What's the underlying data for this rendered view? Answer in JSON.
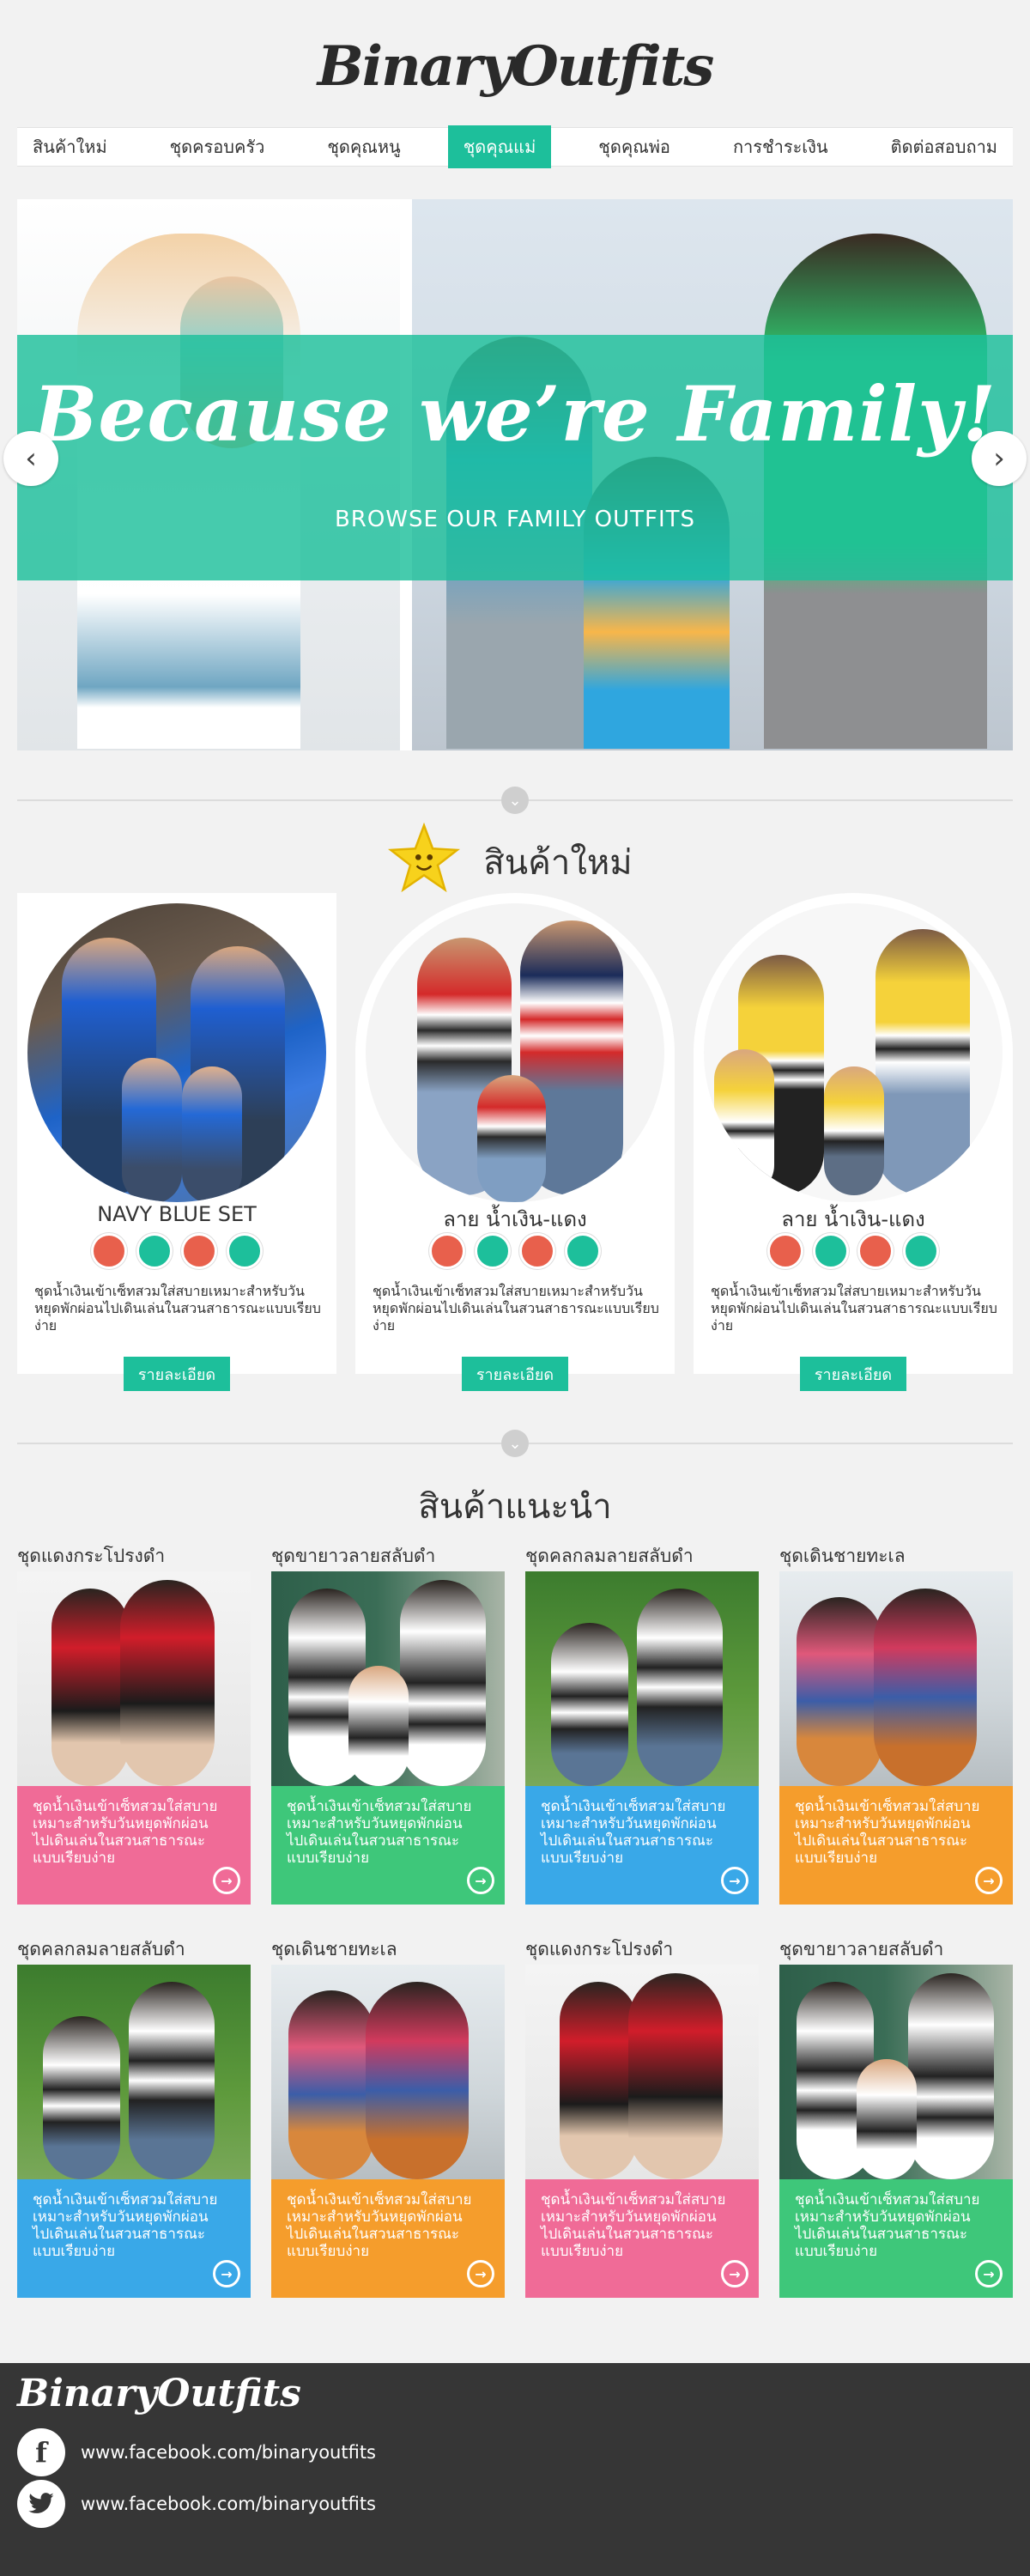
{
  "header": {
    "logo": "BinaryOutfits"
  },
  "nav": {
    "items": [
      {
        "label": "สินค้าใหม่",
        "active": false
      },
      {
        "label": "ชุดครอบครัว",
        "active": false
      },
      {
        "label": "ชุดคุณหนู",
        "active": false
      },
      {
        "label": "ชุดคุณแม่",
        "active": true
      },
      {
        "label": "ชุดคุณพ่อ",
        "active": false
      },
      {
        "label": "การชำระเงิน",
        "active": false
      },
      {
        "label": "ติดต่อสอบถาม",
        "active": false
      }
    ]
  },
  "hero": {
    "title": "Because we’re Family!",
    "subtitle": "BROWSE OUR FAMILY OUTFITS",
    "prev_icon": "chevron-left-icon",
    "next_icon": "chevron-right-icon"
  },
  "new_products": {
    "title": "สินค้าใหม่",
    "icon": "star-icon",
    "items": [
      {
        "name": "NAVY BLUE SET",
        "description": "ชุดน้ำเงินเข้าเซ็ทสวมใส่สบายเหมาะสำหรับวันหยุดพักผ่อนไปเดินเล่นในสวนสาธารณะแบบเรียบง่าย",
        "button": "รายละเอียด",
        "swatches": [
          "#e8604c",
          "#1dbf9b",
          "#e8604c",
          "#1dbf9b"
        ]
      },
      {
        "name": "ลาย น้ำเงิน-แดง",
        "description": "ชุดน้ำเงินเข้าเซ็ทสวมใส่สบายเหมาะสำหรับวันหยุดพักผ่อนไปเดินเล่นในสวนสาธารณะแบบเรียบง่าย",
        "button": "รายละเอียด",
        "swatches": [
          "#e8604c",
          "#1dbf9b",
          "#e8604c",
          "#1dbf9b"
        ]
      },
      {
        "name": "ลาย น้ำเงิน-แดง",
        "description": "ชุดน้ำเงินเข้าเซ็ทสวมใส่สบายเหมาะสำหรับวันหยุดพักผ่อนไปเดินเล่นในสวนสาธารณะแบบเรียบง่าย",
        "button": "รายละเอียด",
        "swatches": [
          "#e8604c",
          "#1dbf9b",
          "#e8604c",
          "#1dbf9b"
        ]
      }
    ]
  },
  "recommended": {
    "title": "สินค้าแนะนำ",
    "items": [
      {
        "title": "ชุดแดงกระโปรงดำ",
        "caption": "ชุดน้ำเงินเข้าเซ็ทสวมใส่สบายเหมาะสำหรับวันหยุดพักผ่อนไปเดินเล่นในสวนสาธารณะแบบเรียบง่าย",
        "color": "#f06b97"
      },
      {
        "title": "ชุดขายาวลายสลับดำ",
        "caption": "ชุดน้ำเงินเข้าเซ็ทสวมใส่สบายเหมาะสำหรับวันหยุดพักผ่อนไปเดินเล่นในสวนสาธารณะแบบเรียบง่าย",
        "color": "#3ec77a"
      },
      {
        "title": "ชุดคลกลมลายสลับดำ",
        "caption": "ชุดน้ำเงินเข้าเซ็ทสวมใส่สบายเหมาะสำหรับวันหยุดพักผ่อนไปเดินเล่นในสวนสาธารณะแบบเรียบง่าย",
        "color": "#39a8e8"
      },
      {
        "title": "ชุดเดินชายทะเล",
        "caption": "ชุดน้ำเงินเข้าเซ็ทสวมใส่สบายเหมาะสำหรับวันหยุดพักผ่อนไปเดินเล่นในสวนสาธารณะแบบเรียบง่าย",
        "color": "#f59d2c"
      },
      {
        "title": "ชุดคลกลมลายสลับดำ",
        "caption": "ชุดน้ำเงินเข้าเซ็ทสวมใส่สบายเหมาะสำหรับวันหยุดพักผ่อนไปเดินเล่นในสวนสาธารณะแบบเรียบง่าย",
        "color": "#39a8e8"
      },
      {
        "title": "ชุดเดินชายทะเล",
        "caption": "ชุดน้ำเงินเข้าเซ็ทสวมใส่สบายเหมาะสำหรับวันหยุดพักผ่อนไปเดินเล่นในสวนสาธารณะแบบเรียบง่าย",
        "color": "#f59d2c"
      },
      {
        "title": "ชุดแดงกระโปรงดำ",
        "caption": "ชุดน้ำเงินเข้าเซ็ทสวมใส่สบายเหมาะสำหรับวันหยุดพักผ่อนไปเดินเล่นในสวนสาธารณะแบบเรียบง่าย",
        "color": "#f06b97"
      },
      {
        "title": "ชุดขายาวลายสลับดำ",
        "caption": "ชุดน้ำเงินเข้าเซ็ทสวมใส่สบายเหมาะสำหรับวันหยุดพักผ่อนไปเดินเล่นในสวนสาธารณะแบบเรียบง่าย",
        "color": "#3ec77a"
      }
    ]
  },
  "footer": {
    "logo": "BinaryOutfits",
    "links": [
      {
        "icon": "facebook-icon",
        "label": "www.facebook.com/binaryoutfits"
      },
      {
        "icon": "twitter-icon",
        "label": "www.facebook.com/binaryoutfits"
      }
    ]
  },
  "colors": {
    "accent": "#1dbf9b",
    "footer_bg": "#363636",
    "page_bg": "#f2f2f2"
  }
}
